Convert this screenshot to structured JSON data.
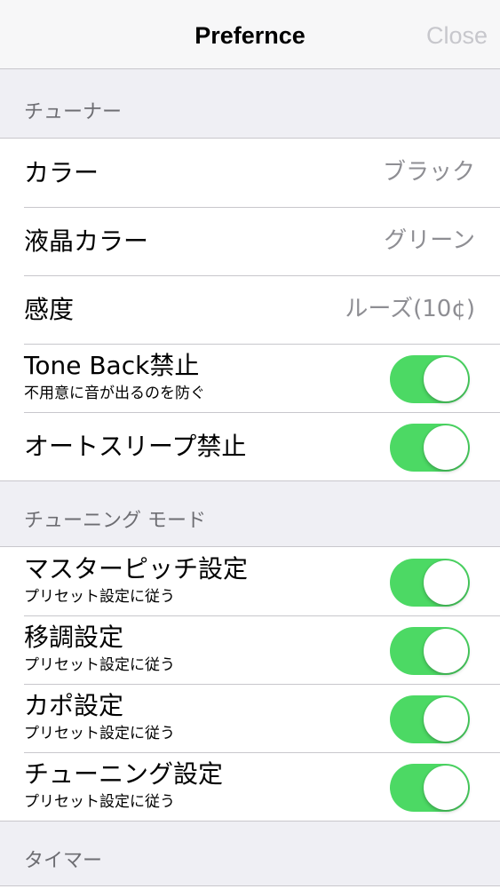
{
  "navbar": {
    "title": "Prefernce",
    "close_label": "Close"
  },
  "colors": {
    "switch_on": "#4cd964",
    "close_text": "#c7c7cc",
    "secondary_text": "#8e8e93",
    "section_header_text": "#6d6d72",
    "background": "#efeff4"
  },
  "sections": [
    {
      "header": "チューナー",
      "rows": [
        {
          "label": "カラー",
          "value": "ブラック"
        },
        {
          "label": "液晶カラー",
          "value": "グリーン"
        },
        {
          "label": "感度",
          "value": "ルーズ(10¢)"
        },
        {
          "label": "Tone Back禁止",
          "subtitle": "不用意に音が出るのを防ぐ",
          "toggle": true
        },
        {
          "label": "オートスリープ禁止",
          "toggle": true
        }
      ]
    },
    {
      "header": "チューニング モード",
      "rows": [
        {
          "label": "マスターピッチ設定",
          "subtitle": "プリセット設定に従う",
          "toggle": true
        },
        {
          "label": "移調設定",
          "subtitle": "プリセット設定に従う",
          "toggle": true
        },
        {
          "label": "カポ設定",
          "subtitle": "プリセット設定に従う",
          "toggle": true
        },
        {
          "label": "チューニング設定",
          "subtitle": "プリセット設定に従う",
          "toggle": true
        }
      ]
    },
    {
      "header": "タイマー",
      "rows": []
    }
  ]
}
